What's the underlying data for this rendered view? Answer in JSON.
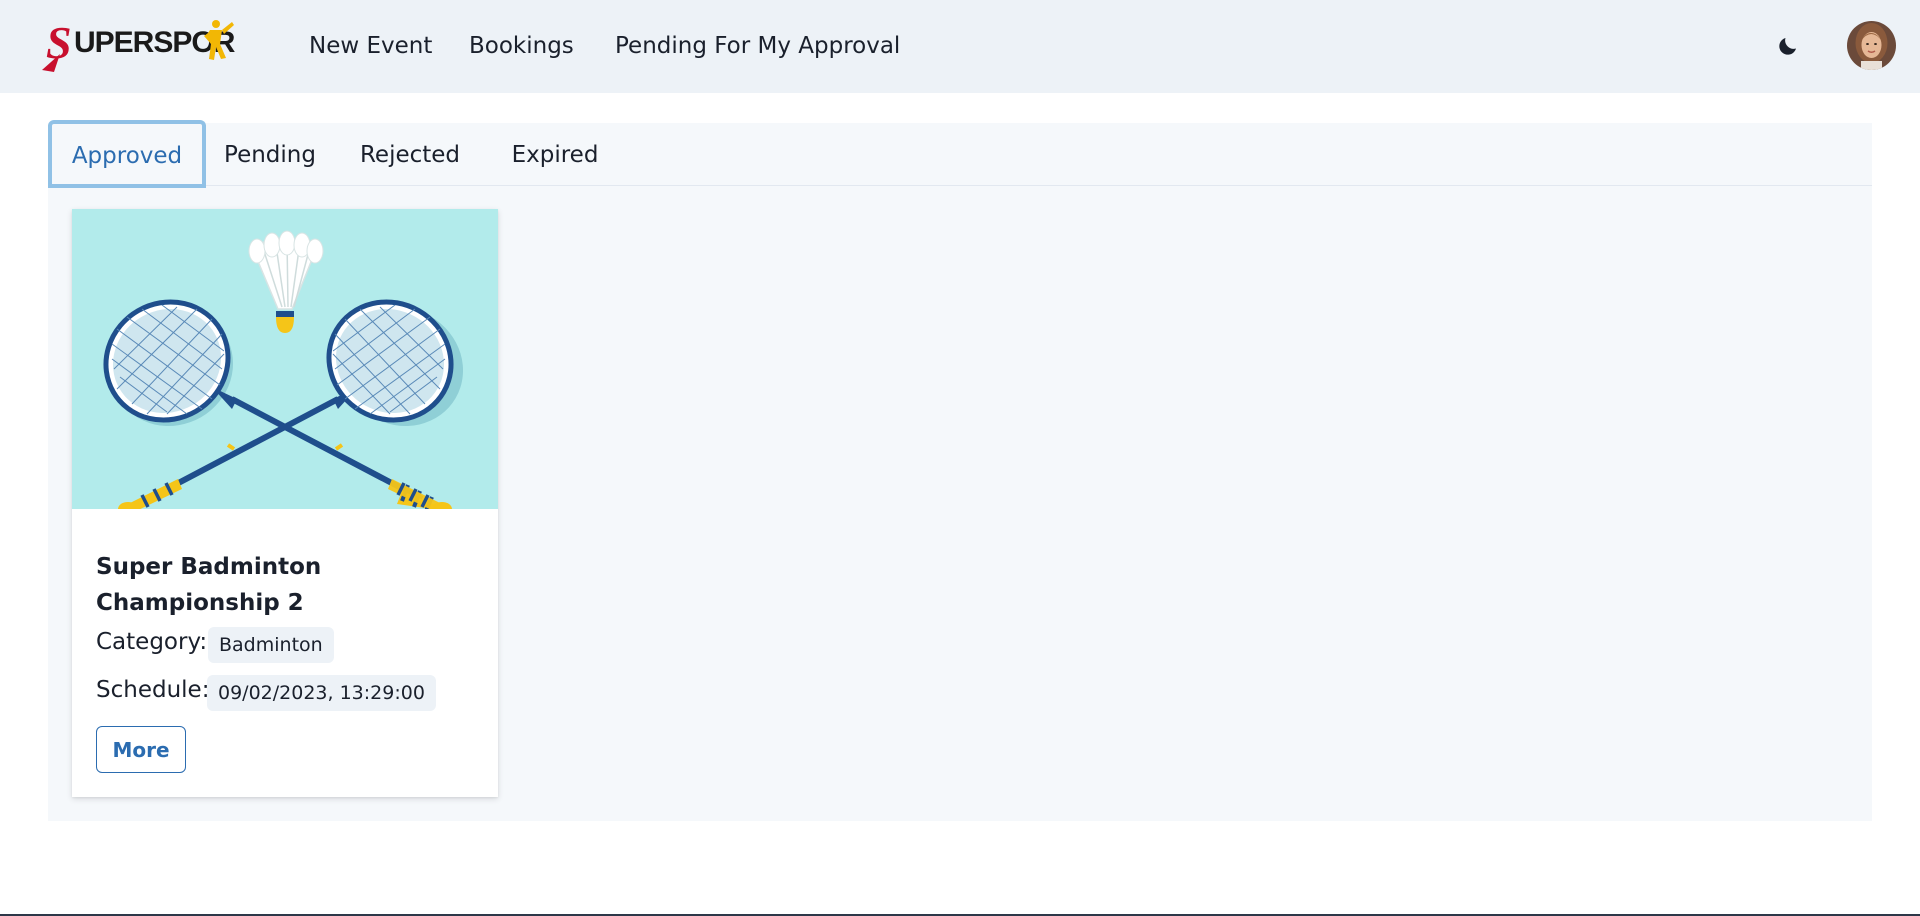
{
  "brand": {
    "logo_text_red": "S",
    "logo_text_rest": "UPERSPOR",
    "logo_alt": "SUPERSPORT"
  },
  "nav": {
    "items": [
      {
        "label": "New Event"
      },
      {
        "label": "Bookings"
      },
      {
        "label": "Pending For My Approval"
      }
    ]
  },
  "header_icons": {
    "theme_toggle": "moon-icon",
    "avatar": "user-avatar"
  },
  "tabs": [
    {
      "label": "Approved",
      "active": true
    },
    {
      "label": "Pending",
      "active": false
    },
    {
      "label": "Rejected",
      "active": false
    },
    {
      "label": "Expired",
      "active": false
    }
  ],
  "events": [
    {
      "title": "Super Badminton Championship 2",
      "category_label": "Category:",
      "category": "Badminton",
      "schedule_label": "Schedule:",
      "schedule": "09/02/2023, 13:29:00",
      "more_label": "More",
      "image": "badminton-rackets-shuttlecock"
    }
  ],
  "colors": {
    "header_bg": "#edf2f7",
    "panel_bg": "#f5f8fb",
    "accent": "#2b6cb0",
    "active_tab_border": "#90c1e6",
    "image_bg": "#b2ebeb"
  }
}
